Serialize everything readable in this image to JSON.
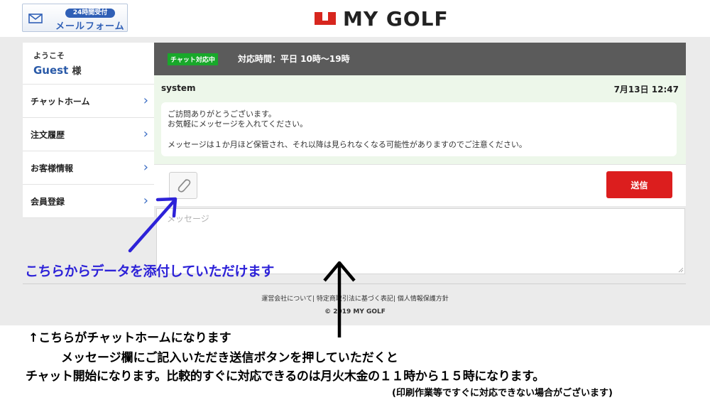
{
  "header": {
    "mail_badge": "24時間受付",
    "mail_label": "メールフォーム",
    "logo_text": "MY GOLF",
    "brand_color": "#d7261e"
  },
  "sidebar": {
    "welcome": "ようこそ",
    "guest_name": "Guest",
    "guest_suffix": "様",
    "items": [
      {
        "label": "チャットホーム"
      },
      {
        "label": "注文履歴"
      },
      {
        "label": "お客様情報"
      },
      {
        "label": "会員登録"
      }
    ]
  },
  "chat": {
    "status_badge": "チャット対応中",
    "hours": "対応時間：平日 10時〜19時",
    "sender": "system",
    "timestamp": "7月13日 12:47",
    "message_lines": [
      "ご訪問ありがとうございます。",
      "お気軽にメッセージを入れてください。",
      "メッセージは１か月ほど保管され、それ以降は見られなくなる可能性がありますのでご注意ください。"
    ],
    "send_label": "送信",
    "input_placeholder": "メッセージ"
  },
  "footer": {
    "links": "運営会社について| 特定商取引法に基づく表記| 個人情報保護方針",
    "copyright": "© 2019 MY GOLF"
  },
  "annotations": {
    "attach_note": "こちらからデータを添付していただけます",
    "caption_line1": "↑こちらがチャットホームになります",
    "caption_line2": "メッセージ欄にご記入いただき送信ボタンを押していただくと",
    "caption_line3": "チャット開始になります。比較的すぐに対応できるのは月火木金の１１時から１５時になります。",
    "caption_line4": "(印刷作業等ですぐに対応できない場合がございます)",
    "note_color": "#2d22d8"
  }
}
